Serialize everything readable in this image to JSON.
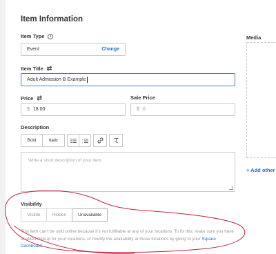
{
  "section_title": "Item Information",
  "item_type": {
    "label": "Item Type",
    "info_icon": "i",
    "value": "Event",
    "change_label": "Change"
  },
  "item_title": {
    "label": "Item Title",
    "value": "Adult Admission B Example"
  },
  "price": {
    "label": "Price",
    "currency": "$",
    "value": "18.00"
  },
  "sale_price": {
    "label": "Sale Price",
    "currency": "$",
    "placeholder": "0"
  },
  "description": {
    "label": "Description",
    "toolbar": [
      "Bold",
      "Italic"
    ],
    "placeholder": "Write a short description of your item."
  },
  "visibility": {
    "label": "Visibility",
    "options": [
      "Visible",
      "Hidden",
      "Unavailable"
    ],
    "selected": "Unavailable",
    "note_prefix": "This item can't be sold online because it's not fulfillable at any of your locations. To fix this, make sure you have enabled Pickup for your locations, or modify the availability at those locations by going to your ",
    "note_link": "Square Dashboard",
    "note_suffix": "."
  },
  "media": {
    "label": "Media",
    "add_label": "+ Add other"
  },
  "colors": {
    "accent": "#2c6fc2",
    "focus": "#3b7ec9",
    "annotation": "#c0283a"
  }
}
